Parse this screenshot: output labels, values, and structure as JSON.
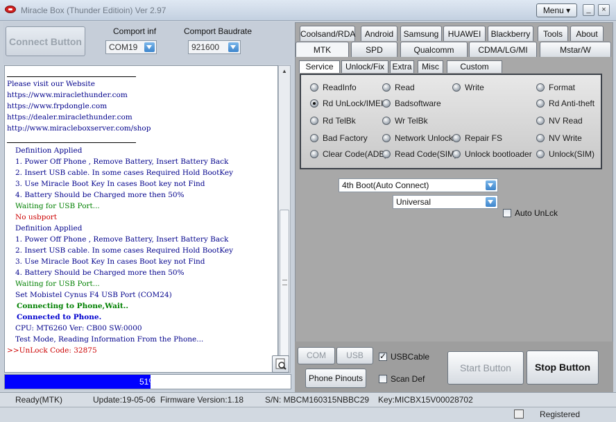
{
  "window": {
    "title": "Miracle Box (Thunder Editioin) Ver 2.97",
    "menu_label": "Menu ▾",
    "minimize_label": "_",
    "close_label": "×"
  },
  "left": {
    "connect_label": "Connect Button",
    "comport_label": "Comport inf",
    "comport_value": "COM19",
    "baud_label": "Comport Baudrate",
    "baud_value": "921600"
  },
  "log": {
    "lines": [
      {
        "text": "Please visit our Website",
        "color": "#00008b",
        "bold": false,
        "indent": 3
      },
      {
        "text": "https://www.miraclethunder.com",
        "color": "#00008b",
        "bold": false,
        "indent": 3
      },
      {
        "text": "https://www.frpdongle.com",
        "color": "#00008b",
        "bold": false,
        "indent": 3
      },
      {
        "text": "https://dealer.miraclethunder.com",
        "color": "#00008b",
        "bold": false,
        "indent": 3
      },
      {
        "text": "http://www.miracleboxserver.com/shop",
        "color": "#00008b",
        "bold": false,
        "indent": 3
      },
      {
        "text": "Definition Applied",
        "color": "#00008b",
        "bold": false,
        "indent": 15
      },
      {
        "text": "1. Power Off Phone , Remove Battery, Insert Battery Back",
        "color": "#00008b",
        "bold": false,
        "indent": 15
      },
      {
        "text": "2. Insert USB cable. In some cases Required Hold BootKey",
        "color": "#00008b",
        "bold": false,
        "indent": 15
      },
      {
        "text": "3. Use Miracle Boot Key In cases Boot key not Find",
        "color": "#00008b",
        "bold": false,
        "indent": 15
      },
      {
        "text": "4. Battery Should be Charged more then 50%",
        "color": "#00008b",
        "bold": false,
        "indent": 15
      },
      {
        "text": "Waiting for USB Port...",
        "color": "#008000",
        "bold": false,
        "indent": 15
      },
      {
        "text": "No usbport",
        "color": "#cc0000",
        "bold": false,
        "indent": 15
      },
      {
        "text": "Definition Applied",
        "color": "#00008b",
        "bold": false,
        "indent": 15
      },
      {
        "text": "1. Power Off Phone , Remove Battery, Insert Battery Back",
        "color": "#00008b",
        "bold": false,
        "indent": 15
      },
      {
        "text": "2. Insert USB cable. In some cases Required Hold BootKey",
        "color": "#00008b",
        "bold": false,
        "indent": 15
      },
      {
        "text": "3. Use Miracle Boot Key In cases Boot key not Find",
        "color": "#00008b",
        "bold": false,
        "indent": 15
      },
      {
        "text": "4. Battery Should be Charged more then 50%",
        "color": "#00008b",
        "bold": false,
        "indent": 15
      },
      {
        "text": "Waiting for USB Port...",
        "color": "#008000",
        "bold": false,
        "indent": 15
      },
      {
        "text": "Set Mobistel Cynus F4 USB Port (COM24)",
        "color": "#00008b",
        "bold": false,
        "indent": 15
      },
      {
        "text": "Connecting to Phone,Wait..",
        "color": "#008000",
        "bold": true,
        "indent": 17
      },
      {
        "text": "Connected to Phone.",
        "color": "#0000cd",
        "bold": true,
        "indent": 17
      },
      {
        "text": "CPU: MT6260 Ver: CB00  SW:0000",
        "color": "#00008b",
        "bold": false,
        "indent": 15
      },
      {
        "text": "Test Mode, Reading Information From the Phone...",
        "color": "#00008b",
        "bold": false,
        "indent": 15
      },
      {
        "text": ">>UnLock Code: 32875",
        "color": "#cc0000",
        "bold": false,
        "indent": 3
      }
    ]
  },
  "progress": {
    "percent": 51,
    "label": "51%"
  },
  "tabs": {
    "row1": [
      "Coolsand/RDA",
      "Android",
      "Samsung",
      "HUAWEI",
      "Blackberry",
      "Tools",
      "About"
    ],
    "row2": [
      "MTK",
      "SPD",
      "Qualcomm",
      "CDMA/LG/MI",
      "Mstar/W"
    ],
    "active_row2": "MTK"
  },
  "subtabs": {
    "items": [
      "Service",
      "Unlock/Fix",
      "Extra",
      "Misc",
      "Custom Setting"
    ],
    "active": "Service"
  },
  "service": {
    "col1": [
      "ReadInfo",
      "Rd UnLock/IMEI",
      "Rd TelBk",
      "Bad Factory",
      "Clear Code(ADB)"
    ],
    "col2": [
      "Read",
      "Badsoftware",
      "Wr TelBk",
      "Network Unlock",
      "Read Code(SIM)"
    ],
    "col3": [
      "Write",
      "",
      "",
      "Repair FS",
      "Unlock bootloader"
    ],
    "col4": [
      "Format",
      "Rd Anti-theft",
      "NV Read",
      "NV Write",
      "Unlock(SIM)"
    ],
    "selected": "Rd UnLock/IMEI"
  },
  "options": {
    "boot_value": "4th Boot(Auto Connect)",
    "mode_value": "Universal",
    "auto_unlock_label": "Auto UnLck",
    "auto_unlock_checked": false
  },
  "bottom": {
    "com_scan": "COM Scan",
    "usb_scan": "USB Scan",
    "usbcable_label": "USBCable",
    "usbcable_checked": true,
    "phone_pinouts": "Phone Pinouts",
    "scan_def_label": "Scan Def",
    "scan_def_checked": false,
    "start_label": "Start Button",
    "stop_label": "Stop Button"
  },
  "status": {
    "ready": "Ready(MTK)",
    "update": "Update:19-05-06",
    "firmware": "Firmware Version:1.18",
    "sn": "S/N: MBCM160315NBBC29",
    "key": "Key:MICBX15V00028702",
    "registered": "Registered"
  },
  "colors": {
    "accent": "#0000ff",
    "panel": "#a8a8a8"
  }
}
